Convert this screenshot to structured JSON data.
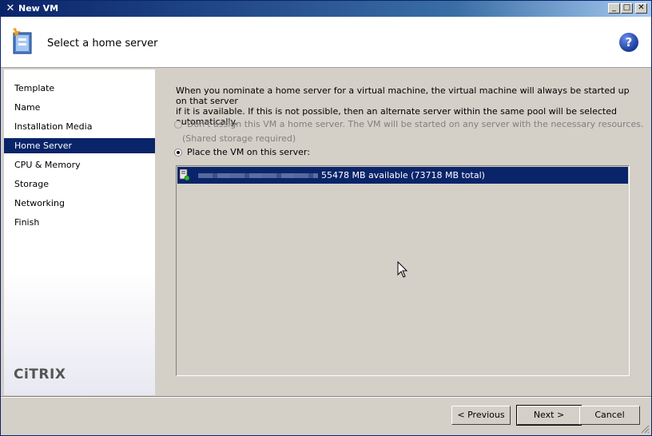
{
  "window": {
    "title": "New VM"
  },
  "header": {
    "heading": "Select a home server"
  },
  "sidebar": {
    "items": [
      {
        "label": "Template",
        "selected": false
      },
      {
        "label": "Name",
        "selected": false
      },
      {
        "label": "Installation Media",
        "selected": false
      },
      {
        "label": "Home Server",
        "selected": true
      },
      {
        "label": "CPU & Memory",
        "selected": false
      },
      {
        "label": "Storage",
        "selected": false
      },
      {
        "label": "Networking",
        "selected": false
      },
      {
        "label": "Finish",
        "selected": false
      }
    ],
    "logo": "CiTRIX"
  },
  "main": {
    "description_line1": "When you nominate a home server for a virtual machine, the virtual machine will always be started up on that server",
    "description_line2": "if it is available. If this is not possible, then an alternate server within the same pool will be selected automatically.",
    "option_no_home": "Don't assign this VM a home server. The VM will be started on any server with the necessary resources.",
    "option_no_home_note": "(Shared storage required)",
    "option_place": "Place the VM on this server:",
    "servers": [
      {
        "availability": "55478 MB available (73718 MB total)",
        "selected": true
      }
    ]
  },
  "buttons": {
    "previous": "< Previous",
    "next": "Next >",
    "cancel": "Cancel"
  },
  "colors": {
    "selection": "#0a246a",
    "accent": "#1a3a9a"
  }
}
